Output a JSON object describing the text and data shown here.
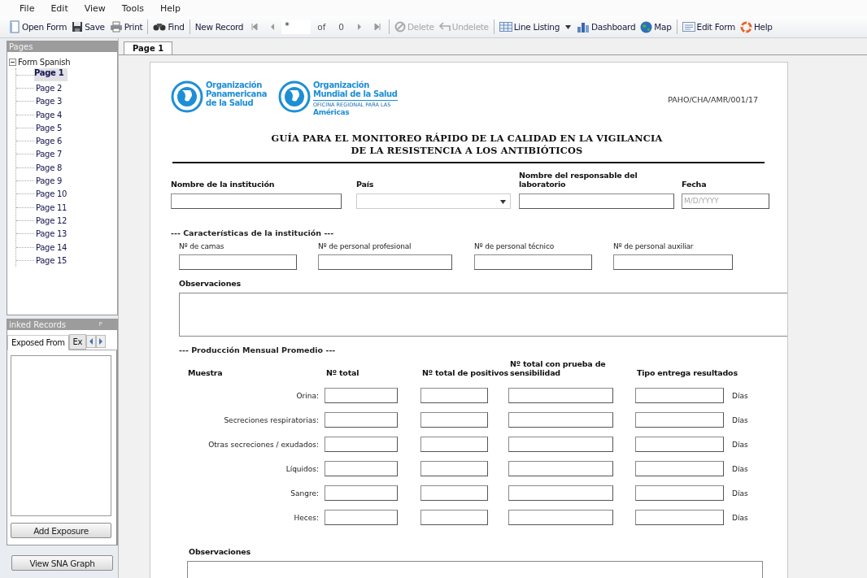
{
  "menu": [
    "File",
    "Edit",
    "View",
    "Tools",
    "Help"
  ],
  "toolbar": [
    {
      "kind": "button",
      "label": "Open Form",
      "disabled": false
    },
    {
      "kind": "button",
      "label": "Save",
      "disabled": false
    },
    {
      "kind": "button",
      "label": "Print",
      "disabled": false
    },
    {
      "kind": "separator"
    },
    {
      "kind": "button",
      "label": "Find",
      "disabled": false
    },
    {
      "kind": "separator"
    },
    {
      "kind": "button",
      "label": "New Record",
      "disabled": false
    },
    {
      "kind": "first"
    },
    {
      "kind": "prev"
    },
    {
      "kind": "record",
      "value": "*"
    },
    {
      "kind": "label",
      "label": "of"
    },
    {
      "kind": "label",
      "label": "0"
    },
    {
      "kind": "next"
    },
    {
      "kind": "last"
    },
    {
      "kind": "separator"
    },
    {
      "kind": "button",
      "label": "Delete",
      "disabled": true
    },
    {
      "kind": "button",
      "label": "Undelete",
      "disabled": true
    },
    {
      "kind": "separator"
    },
    {
      "kind": "button",
      "label": "Line Listing",
      "disabled": false
    },
    {
      "kind": "dropdown"
    },
    {
      "kind": "button",
      "label": "Dashboard",
      "disabled": false
    },
    {
      "kind": "button",
      "label": "Map",
      "disabled": false
    },
    {
      "kind": "separator"
    },
    {
      "kind": "button",
      "label": "Edit Form",
      "disabled": false
    },
    {
      "kind": "button",
      "label": "Help",
      "disabled": false
    }
  ],
  "pages_panel": {
    "title": "Pages",
    "tree": {
      "label": "Form Spanish",
      "expanded": true,
      "children": [
        {
          "label": "Page 1",
          "selected": true
        },
        {
          "label": "Page 2",
          "selected": false
        },
        {
          "label": "Page 3",
          "selected": false
        },
        {
          "label": "Page 4",
          "selected": false
        },
        {
          "label": "Page 5",
          "selected": false
        },
        {
          "label": "Page 6",
          "selected": false
        },
        {
          "label": "Page 7",
          "selected": false
        },
        {
          "label": "Page 8",
          "selected": false
        },
        {
          "label": "Page 9",
          "selected": false
        },
        {
          "label": "Page 10",
          "selected": false
        },
        {
          "label": "Page 11",
          "selected": false
        },
        {
          "label": "Page 12",
          "selected": false
        },
        {
          "label": "Page 13",
          "selected": false
        },
        {
          "label": "Page 14",
          "selected": false
        },
        {
          "label": "Page 15",
          "selected": false
        }
      ]
    }
  },
  "linked_records": {
    "title": "inked Records",
    "pin": "ᵖ",
    "tabs": [
      {
        "label": "Exposed From",
        "selected": true
      },
      {
        "label": "Ex",
        "selected": false
      }
    ],
    "button": "Add Exposure"
  },
  "sna_button": "View SNA Graph",
  "document_tabs": [
    {
      "label": "Page 1",
      "selected": true
    }
  ],
  "form": {
    "logos": [
      {
        "lines": [
          "Organización",
          "Panamericana",
          "de la Salud"
        ]
      },
      {
        "lines": [
          "Organización",
          "Mundial de la Salud"
        ],
        "subtitle": "OFICINA REGIONAL PARA LAS",
        "region": "Américas"
      }
    ],
    "code": "PAHO/CHA/AMR/001/17",
    "title": [
      "GUÍA PARA EL MONITOREO RÁPIDO DE LA CALIDAD EN LA VIGILANCIA",
      "DE LA RESISTENCIA A LOS ANTIBIÓTICOS"
    ],
    "fields": [
      {
        "label": "Nombre de la institución",
        "kind": "text"
      },
      {
        "label": "País",
        "kind": "select"
      },
      {
        "label": "Nombre del responsable del laboratorio",
        "kind": "text"
      },
      {
        "label": "Fecha",
        "kind": "date",
        "placeholder": "M/D/YYYY"
      }
    ],
    "characteristics": {
      "heading": "--- Características de la institución ---",
      "fields": [
        "Nº de camas",
        "Nº de personal profesional",
        "Nº de personal técnico",
        "Nº de personal auxiliar"
      ]
    },
    "observations_label": "Observaciones",
    "production": {
      "heading": "--- Producción Mensual Promedio ---",
      "columns": [
        "Muestra",
        "Nº total",
        "Nº total de positivos",
        "Nº total con prueba de sensibilidad",
        "Tipo entrega resultados"
      ],
      "rows": [
        {
          "label": "Orina:",
          "unit": "Días"
        },
        {
          "label": "Secreciones respiratorias:",
          "unit": "Días"
        },
        {
          "label": "Otras secreciones / exudados:",
          "unit": "Días"
        },
        {
          "label": "Líquidos:",
          "unit": "Días"
        },
        {
          "label": "Sangre:",
          "unit": "Días"
        },
        {
          "label": "Heces:",
          "unit": "Días"
        }
      ]
    },
    "observations_label_2": "Observaciones"
  }
}
